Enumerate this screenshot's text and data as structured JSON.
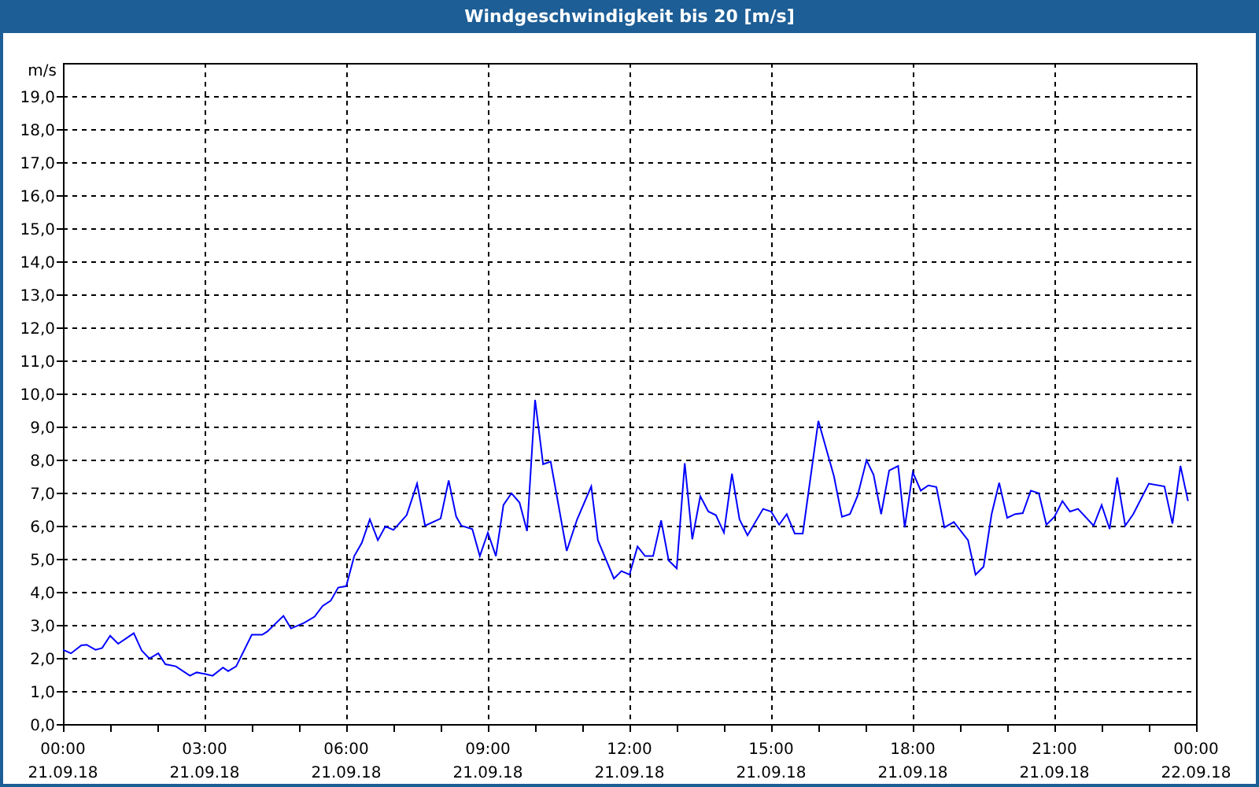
{
  "window": {
    "title": "Windgeschwindigkeit bis 20 [m/s]"
  },
  "chart": {
    "x_axis_dates": [
      "21.09.18",
      "21.09.18",
      "21.09.18",
      "21.09.18",
      "21.09.18",
      "21.09.18",
      "21.09.18",
      "21.09.18",
      "22.09.18"
    ],
    "chart_data": {
      "type": "line",
      "ylabel": "m/s",
      "xlim": [
        0,
        24
      ],
      "ylim": [
        0,
        20
      ],
      "yticks": [
        {
          "value": 0,
          "label": "0,0"
        },
        {
          "value": 1,
          "label": "1,0"
        },
        {
          "value": 2,
          "label": "2,0"
        },
        {
          "value": 3,
          "label": "3,0"
        },
        {
          "value": 4,
          "label": "4,0"
        },
        {
          "value": 5,
          "label": "5,0"
        },
        {
          "value": 6,
          "label": "6,0"
        },
        {
          "value": 7,
          "label": "7,0"
        },
        {
          "value": 8,
          "label": "8,0"
        },
        {
          "value": 9,
          "label": "9,0"
        },
        {
          "value": 10,
          "label": "10,0"
        },
        {
          "value": 11,
          "label": "11,0"
        },
        {
          "value": 12,
          "label": "12,0"
        },
        {
          "value": 13,
          "label": "13,0"
        },
        {
          "value": 14,
          "label": "14,0"
        },
        {
          "value": 15,
          "label": "15,0"
        },
        {
          "value": 16,
          "label": "16,0"
        },
        {
          "value": 17,
          "label": "17,0"
        },
        {
          "value": 18,
          "label": "18,0"
        },
        {
          "value": 19,
          "label": "19,0"
        }
      ],
      "grid": true,
      "xticks": [
        {
          "value": 0,
          "label": "00:00"
        },
        {
          "value": 3,
          "label": "03:00"
        },
        {
          "value": 6,
          "label": "06:00"
        },
        {
          "value": 9,
          "label": "09:00"
        },
        {
          "value": 12,
          "label": "12:00"
        },
        {
          "value": 15,
          "label": "15:00"
        },
        {
          "value": 18,
          "label": "18:00"
        },
        {
          "value": 21,
          "label": "21:00"
        },
        {
          "value": 24,
          "label": "00:00"
        }
      ],
      "x": [
        0,
        0.17,
        0.39,
        0.5,
        0.69,
        0.83,
        1.0,
        1.17,
        1.5,
        1.67,
        1.83,
        2.02,
        2.17,
        2.39,
        2.69,
        2.83,
        3.0,
        3.17,
        3.39,
        3.5,
        3.67,
        4.0,
        4.22,
        4.33,
        4.67,
        4.83,
        5.11,
        5.33,
        5.5,
        5.67,
        5.83,
        6.0,
        6.17,
        6.33,
        6.5,
        6.67,
        6.83,
        7.0,
        7.28,
        7.5,
        7.67,
        8.0,
        8.17,
        8.33,
        8.44,
        8.67,
        8.83,
        9.0,
        9.17,
        9.33,
        9.5,
        9.67,
        9.83,
        10.0,
        10.17,
        10.33,
        10.67,
        10.89,
        11.19,
        11.33,
        11.67,
        11.83,
        12.0,
        12.17,
        12.33,
        12.5,
        12.67,
        12.83,
        13.0,
        13.17,
        13.33,
        13.5,
        13.67,
        13.83,
        14.0,
        14.17,
        14.33,
        14.5,
        14.83,
        15.0,
        15.17,
        15.33,
        15.5,
        15.67,
        16.0,
        16.33,
        16.5,
        16.67,
        16.83,
        17.02,
        17.17,
        17.33,
        17.5,
        17.69,
        17.83,
        18.0,
        18.17,
        18.33,
        18.5,
        18.67,
        18.87,
        19.17,
        19.33,
        19.5,
        19.67,
        19.83,
        20.0,
        20.17,
        20.33,
        20.5,
        20.67,
        20.83,
        21.0,
        21.17,
        21.33,
        21.5,
        21.83,
        22.0,
        22.17,
        22.33,
        22.5,
        22.67,
        23.0,
        23.33,
        23.5,
        23.67,
        23.83
      ],
      "series": [
        {
          "color": "#0000ff",
          "values": [
            2.25,
            2.14,
            2.38,
            2.4,
            2.25,
            2.3,
            2.67,
            2.43,
            2.75,
            2.22,
            1.98,
            2.14,
            1.81,
            1.75,
            1.46,
            1.56,
            1.52,
            1.46,
            1.71,
            1.6,
            1.75,
            2.7,
            2.7,
            2.8,
            3.27,
            2.89,
            3.06,
            3.25,
            3.57,
            3.73,
            4.13,
            4.17,
            5.08,
            5.48,
            6.19,
            5.56,
            5.98,
            5.87,
            6.32,
            7.27,
            6.0,
            6.22,
            7.37,
            6.27,
            6.0,
            5.9,
            5.08,
            5.79,
            5.08,
            6.63,
            6.98,
            6.7,
            5.84,
            9.81,
            7.86,
            7.94,
            5.24,
            6.19,
            7.19,
            5.56,
            4.4,
            4.63,
            4.52,
            5.37,
            5.08,
            5.08,
            6.16,
            4.95,
            4.71,
            7.89,
            5.59,
            6.89,
            6.43,
            6.32,
            5.79,
            7.57,
            6.19,
            5.71,
            6.51,
            6.43,
            6.03,
            6.35,
            5.76,
            5.76,
            9.17,
            7.5,
            6.27,
            6.35,
            6.9,
            7.98,
            7.54,
            6.35,
            7.67,
            7.81,
            5.95,
            7.62,
            7.06,
            7.22,
            7.17,
            5.95,
            6.11,
            5.56,
            4.52,
            4.76,
            6.35,
            7.3,
            6.24,
            6.35,
            6.38,
            7.06,
            6.98,
            6.03,
            6.27,
            6.75,
            6.43,
            6.51,
            6.0,
            6.63,
            5.9,
            7.46,
            6.0,
            6.35,
            7.27,
            7.19,
            6.06,
            7.81,
            6.75
          ]
        }
      ]
    }
  }
}
